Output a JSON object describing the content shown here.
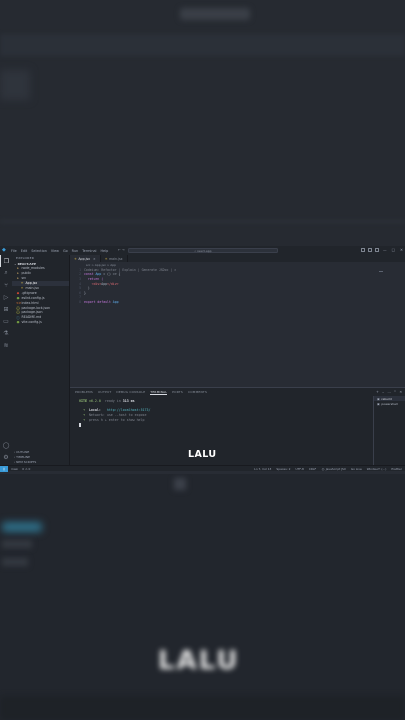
{
  "menu": [
    "File",
    "Edit",
    "Selection",
    "View",
    "Go",
    "Run",
    "Terminal",
    "Help"
  ],
  "command_center": "react-app",
  "sidebar": {
    "header": "EXPLORER",
    "project": "REACT-APP",
    "items": [
      {
        "label": "node_modules",
        "icon": "folder-icon",
        "indent": 1
      },
      {
        "label": "public",
        "icon": "folder-icon",
        "indent": 1
      },
      {
        "label": "src",
        "icon": "folder-open-icon",
        "indent": 1
      },
      {
        "label": "App.jsx",
        "icon": "react-file-icon",
        "indent": 2,
        "selected": true
      },
      {
        "label": "main.jsx",
        "icon": "react-file-icon",
        "indent": 2
      },
      {
        "label": ".gitignore",
        "icon": "git-icon",
        "indent": 1
      },
      {
        "label": "eslint.config.js",
        "icon": "config-icon",
        "indent": 1
      },
      {
        "label": "index.html",
        "icon": "html-icon",
        "indent": 1
      },
      {
        "label": "package-lock.json",
        "icon": "json-icon",
        "indent": 1
      },
      {
        "label": "package.json",
        "icon": "json-icon",
        "indent": 1
      },
      {
        "label": "README.md",
        "icon": "markdown-icon",
        "indent": 1
      },
      {
        "label": "vite.config.js",
        "icon": "config-icon",
        "indent": 1
      }
    ],
    "sections": [
      "OUTLINE",
      "TIMELINE",
      "NPM SCRIPTS"
    ]
  },
  "editor": {
    "tabs": [
      {
        "label": "App.jsx",
        "active": true
      },
      {
        "label": "main.jsx",
        "active": false
      }
    ],
    "breadcrumb": "src > App.jsx > App",
    "lines": [
      {
        "n": "1",
        "parts": [
          {
            "t": "Codeium: Refactor | Explain | Generate JSDoc | ×",
            "c": "cm"
          }
        ]
      },
      {
        "n": "2",
        "parts": [
          {
            "t": "const ",
            "c": "kw"
          },
          {
            "t": "App",
            "c": "fn"
          },
          {
            "t": " = () => {",
            "c": "plain"
          }
        ]
      },
      {
        "n": "3",
        "parts": [
          {
            "t": "  return (",
            "c": "kw"
          }
        ]
      },
      {
        "n": "4",
        "parts": [
          {
            "t": "    <div>",
            "c": "tag"
          },
          {
            "t": "App",
            "c": "plain"
          },
          {
            "t": "</div>",
            "c": "tag"
          }
        ]
      },
      {
        "n": "5",
        "parts": [
          {
            "t": "  )",
            "c": "plain"
          }
        ]
      },
      {
        "n": "6",
        "parts": [
          {
            "t": "}",
            "c": "plain"
          }
        ]
      },
      {
        "n": "7",
        "parts": [
          {
            "t": "",
            "c": "plain"
          }
        ]
      },
      {
        "n": "8",
        "parts": [
          {
            "t": "export default ",
            "c": "kw"
          },
          {
            "t": "App",
            "c": "fn"
          }
        ]
      }
    ]
  },
  "panel": {
    "tabs": [
      "PROBLEMS",
      "OUTPUT",
      "DEBUG CONSOLE",
      "TERMINAL",
      "PORTS",
      "COMMENTS"
    ],
    "active_tab": "TERMINAL",
    "terminal": {
      "vite": "VITE",
      "version": "v6.2.0",
      "ready_prefix": "ready in",
      "ready_ms": "313 ms",
      "local_label": "Local:",
      "local_url": "http://localhost:5173/",
      "network_label": "Network:",
      "network_text": "use --host to expose",
      "help_text": "press h + enter to show help"
    },
    "terminals": [
      "rebuild",
      "powershell"
    ]
  },
  "statusbar": {
    "left": [
      "main",
      "0 ⚠ 0"
    ],
    "right": [
      "Ln 7, Col 13",
      "Spaces: 2",
      "UTF-8",
      "CRLF",
      "{} JavaScript JSX",
      "Go Live",
      "Windsurf: (...)",
      "Prettier"
    ]
  },
  "caption": "LALU",
  "blurred_watermark": "LALU"
}
